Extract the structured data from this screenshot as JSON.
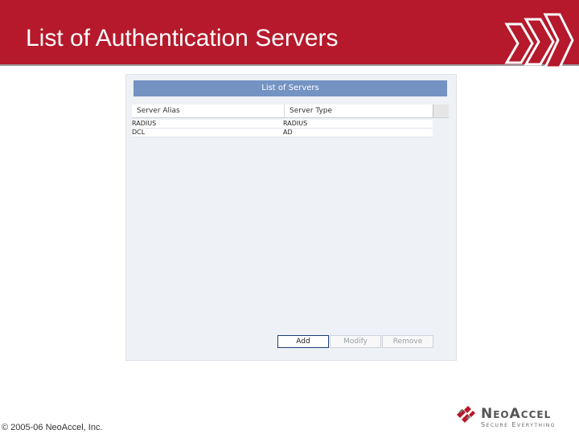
{
  "slide": {
    "title": "List of Authentication Servers",
    "copyright": "© 2005-06 NeoAccel, Inc.",
    "colors": {
      "title_bar": "#b5192b",
      "dialog_header": "#7493c3"
    },
    "icons": [
      "chevron-right-icon",
      "neoaccel-logo-icon"
    ]
  },
  "dialog": {
    "header": "List of Servers",
    "columns": [
      "Server Alias",
      "Server Type"
    ],
    "rows": [
      {
        "alias": "RADIUS",
        "type": "RADIUS"
      },
      {
        "alias": "DCL",
        "type": "AD"
      }
    ],
    "buttons": {
      "add": "Add",
      "modify": "Modify",
      "remove": "Remove"
    },
    "button_states": {
      "add": "enabled",
      "modify": "disabled",
      "remove": "disabled"
    }
  },
  "logo": {
    "brand": "NeoAccel",
    "tagline": "Secure Everything"
  }
}
